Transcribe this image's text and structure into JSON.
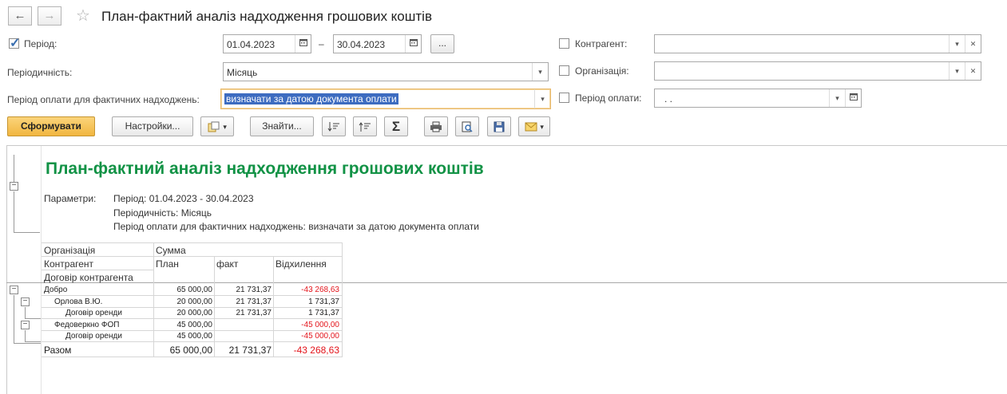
{
  "window": {
    "title": "План-фактний аналіз надходження грошових коштів",
    "back_icon": "←",
    "forward_icon": "→",
    "star_icon": "☆"
  },
  "filters": {
    "period_label": "Період:",
    "period_checked": true,
    "period_from": "01.04.2023",
    "period_dash": "–",
    "period_to": "30.04.2023",
    "period_more": "...",
    "periodicity_label": "Періодичність:",
    "periodicity_value": "Місяць",
    "payment_period_label": "Період оплати для фактичних надходжень:",
    "payment_period_value": "визначати за датою документа оплати",
    "counterparty_label": "Контрагент:",
    "counterparty_value": "",
    "organization_label": "Організація:",
    "organization_value": "",
    "payment_date_label": "Період оплати:",
    "payment_date_value": ". ."
  },
  "toolbar": {
    "generate_label": "Сформувати",
    "settings_label": "Настройки...",
    "find_label": "Знайти...",
    "sum_icon": "Σ"
  },
  "report": {
    "title": "План-фактний аналіз надходження грошових коштів",
    "params_label": "Параметри:",
    "param_period": "Період: 01.04.2023 - 30.04.2023",
    "param_periodicity": "Періодичність: Місяць",
    "param_payment": "Період оплати для фактичних надходжень: визначати за датою документа оплати",
    "headers": {
      "organization": "Організація",
      "counterparty": "Контрагент",
      "contract": "Договір контрагента",
      "sum": "Сумма",
      "plan": "План",
      "fact": "факт",
      "deviation": "Відхилення"
    },
    "rows": [
      {
        "name": "Добро",
        "plan": "65 000,00",
        "fact": "21 731,37",
        "dev": "-43 268,63",
        "neg": true
      },
      {
        "name": "Орлова В.Ю.",
        "plan": "20 000,00",
        "fact": "21 731,37",
        "dev": "1 731,37",
        "neg": false
      },
      {
        "name": "Договір оренди",
        "plan": "20 000,00",
        "fact": "21 731,37",
        "dev": "1 731,37",
        "neg": false
      },
      {
        "name": "Федоверкно ФОП",
        "plan": "45 000,00",
        "fact": "",
        "dev": "-45 000,00",
        "neg": true
      },
      {
        "name": "Договір оренди",
        "plan": "45 000,00",
        "fact": "",
        "dev": "-45 000,00",
        "neg": true
      }
    ],
    "total": {
      "name": "Разом",
      "plan": "65 000,00",
      "fact": "21 731,37",
      "dev": "-43 268,63"
    }
  },
  "colors": {
    "report_title": "#119245",
    "negative": "#e3141b",
    "primary_button": "#f1b640",
    "selection": "#3d6cc0"
  }
}
